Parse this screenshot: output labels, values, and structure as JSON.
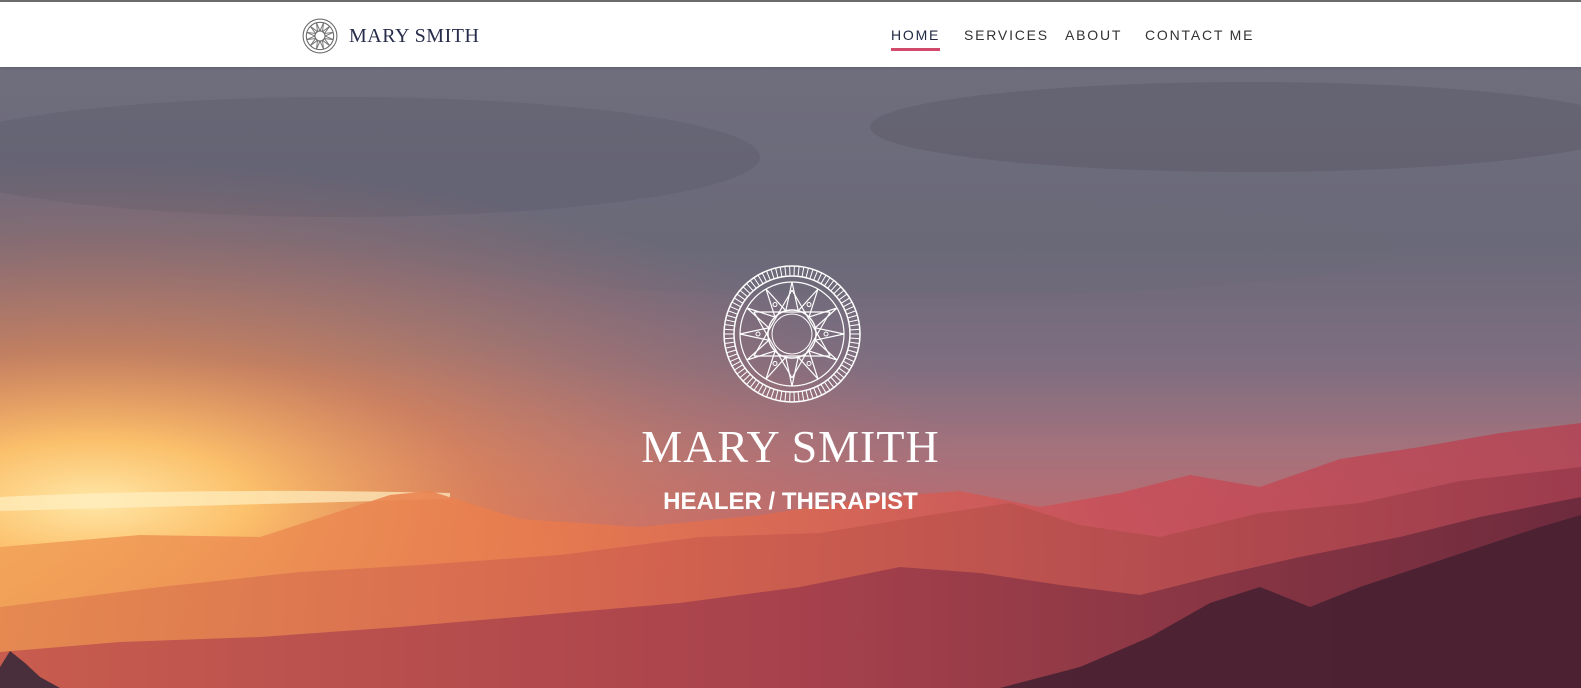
{
  "header": {
    "brand_name": "MARY SMITH",
    "brand_icon": "mandala-logo-icon"
  },
  "nav": {
    "items": [
      {
        "label": "HOME",
        "active": true
      },
      {
        "label": "SERVICES",
        "active": false
      },
      {
        "label": "ABOUT",
        "active": false
      },
      {
        "label": "CONTACT ME",
        "active": false
      }
    ]
  },
  "hero": {
    "title": "MARY SMITH",
    "subtitle": "HEALER / THERAPIST",
    "icon": "mandala-logo-icon",
    "background": "mountain-sunset-photo"
  },
  "colors": {
    "accent": "#d1496b",
    "brand_text": "#262c4a",
    "nav_text": "#333333"
  }
}
